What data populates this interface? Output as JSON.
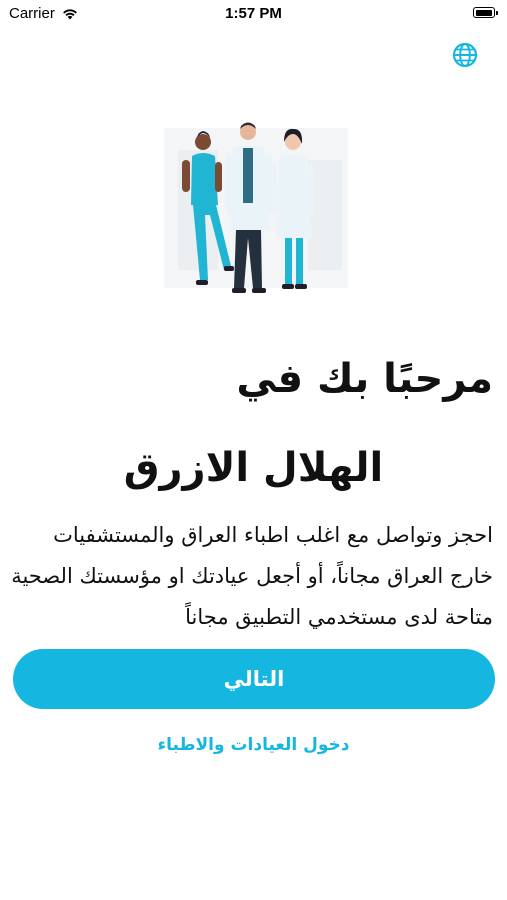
{
  "status_bar": {
    "carrier": "Carrier",
    "time": "1:57 PM",
    "icons": [
      "wifi-icon",
      "battery-icon"
    ]
  },
  "header": {
    "language_icon": "globe-icon"
  },
  "illustration": {
    "icon": "doctors-illustration"
  },
  "welcome": {
    "title": "مرحبًا بك في",
    "brand": "الهلال الازرق",
    "description": "احجز وتواصل مع اغلب اطباء العراق والمستشفيات خارج العراق مجاناً، أو أجعل عيادتك او مؤسستك الصحية متاحة لدى مستخدمي التطبيق مجاناً"
  },
  "actions": {
    "next_label": "التالي",
    "clinics_login_label": "دخول العيادات والاطباء"
  },
  "colors": {
    "accent": "#15b7e0",
    "text": "#111111",
    "background": "#ffffff"
  }
}
